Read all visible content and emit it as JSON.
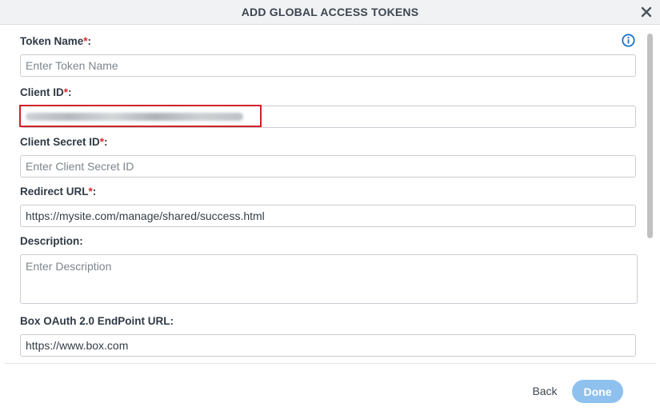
{
  "dialog": {
    "title": "ADD GLOBAL ACCESS TOKENS"
  },
  "icons": {
    "close": "close-icon",
    "info": "info-icon"
  },
  "fields": {
    "token_name": {
      "label": "Token Name",
      "required_mark": "*",
      "suffix": ":",
      "value": "",
      "placeholder": "Enter Token Name"
    },
    "client_id": {
      "label": "Client ID",
      "required_mark": "*",
      "suffix": ":",
      "value": "",
      "placeholder": ""
    },
    "client_secret_id": {
      "label": "Client Secret ID",
      "required_mark": "*",
      "suffix": ":",
      "value": "",
      "placeholder": "Enter Client Secret ID"
    },
    "redirect_url": {
      "label": "Redirect URL",
      "required_mark": "*",
      "suffix": ":",
      "value": "https://mysite.com/manage/shared/success.html",
      "placeholder": ""
    },
    "description": {
      "label": "Description:",
      "value": "",
      "placeholder": "Enter Description"
    },
    "endpoint_url": {
      "label": "Box OAuth 2.0 EndPoint URL:",
      "value": "https://www.box.com",
      "placeholder": ""
    }
  },
  "footer": {
    "back_label": "Back",
    "done_label": "Done"
  },
  "colors": {
    "accent": "#1a73c9",
    "required": "#d9262c",
    "done_button": "#8fc1ef",
    "highlight": "#d0222a"
  }
}
